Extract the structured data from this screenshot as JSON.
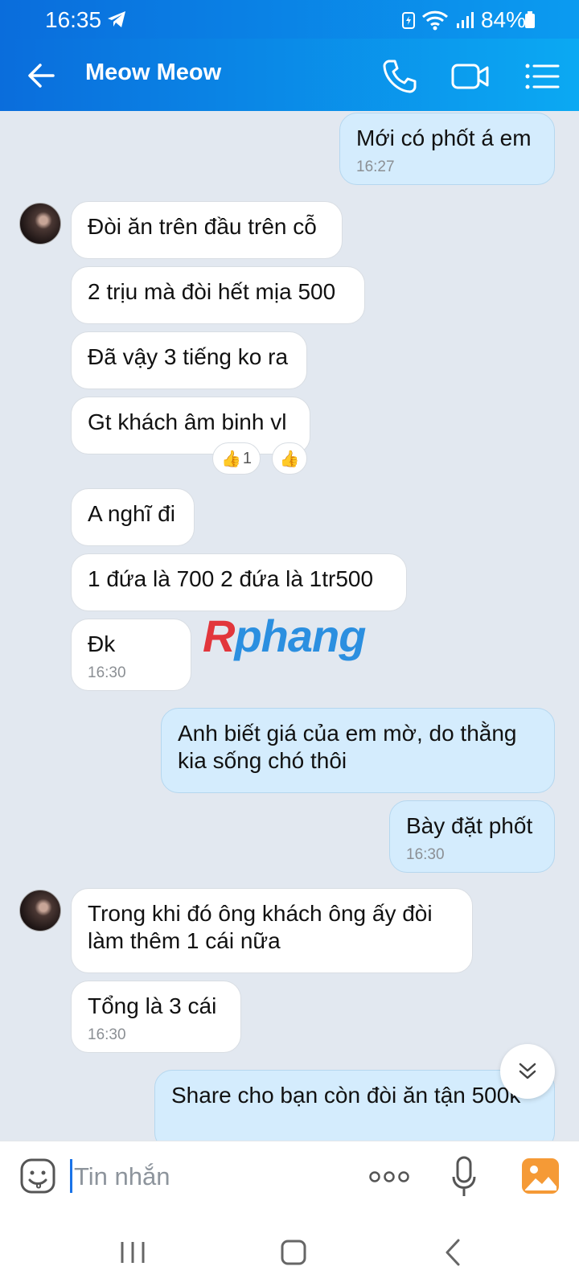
{
  "status_bar": {
    "time": "16:35",
    "battery": "84%"
  },
  "header": {
    "title": "Meow Meow",
    "icons": [
      "back-arrow-icon",
      "phone-icon",
      "video-call-icon",
      "list-menu-icon"
    ]
  },
  "messages": [
    {
      "side": "out",
      "text": "Mới có phốt á em",
      "time": "16:27"
    },
    {
      "side": "in",
      "text": "Đòi ăn trên đầu trên cỗ"
    },
    {
      "side": "in",
      "text": "2 trịu mà đòi hết mịa 500"
    },
    {
      "side": "in",
      "text": "Đã vậy 3 tiếng ko ra"
    },
    {
      "side": "in",
      "text": "Gt khách âm binh vl",
      "reaction_count": "1"
    },
    {
      "side": "in",
      "text": "A nghĩ đi"
    },
    {
      "side": "in",
      "text": "1 đứa là 700 2 đứa là 1tr500"
    },
    {
      "side": "in",
      "text": "Đk",
      "time": "16:30"
    },
    {
      "side": "out",
      "text": "Anh biết giá của em mờ, do thằng kia sống chó thôi"
    },
    {
      "side": "out",
      "text": "Bày đặt phốt",
      "time": "16:30"
    },
    {
      "side": "in",
      "text": "Trong khi đó ông khách ông ấy đòi làm thêm 1 cái nữa"
    },
    {
      "side": "in",
      "text": "Tổng là 3 cái",
      "time": "16:30"
    },
    {
      "side": "out",
      "text": "Share cho bạn còn đòi ăn tận 500k"
    }
  ],
  "watermark": {
    "part1": "R",
    "part2": "phang"
  },
  "input": {
    "placeholder": "Tin nhắn",
    "value": ""
  },
  "colors": {
    "header_start": "#0a6ddc",
    "header_end": "#0ba9f3",
    "chat_bg": "#e2e8f0",
    "outgoing_bubble": "#d4ecfd",
    "incoming_bubble": "#ffffff"
  }
}
